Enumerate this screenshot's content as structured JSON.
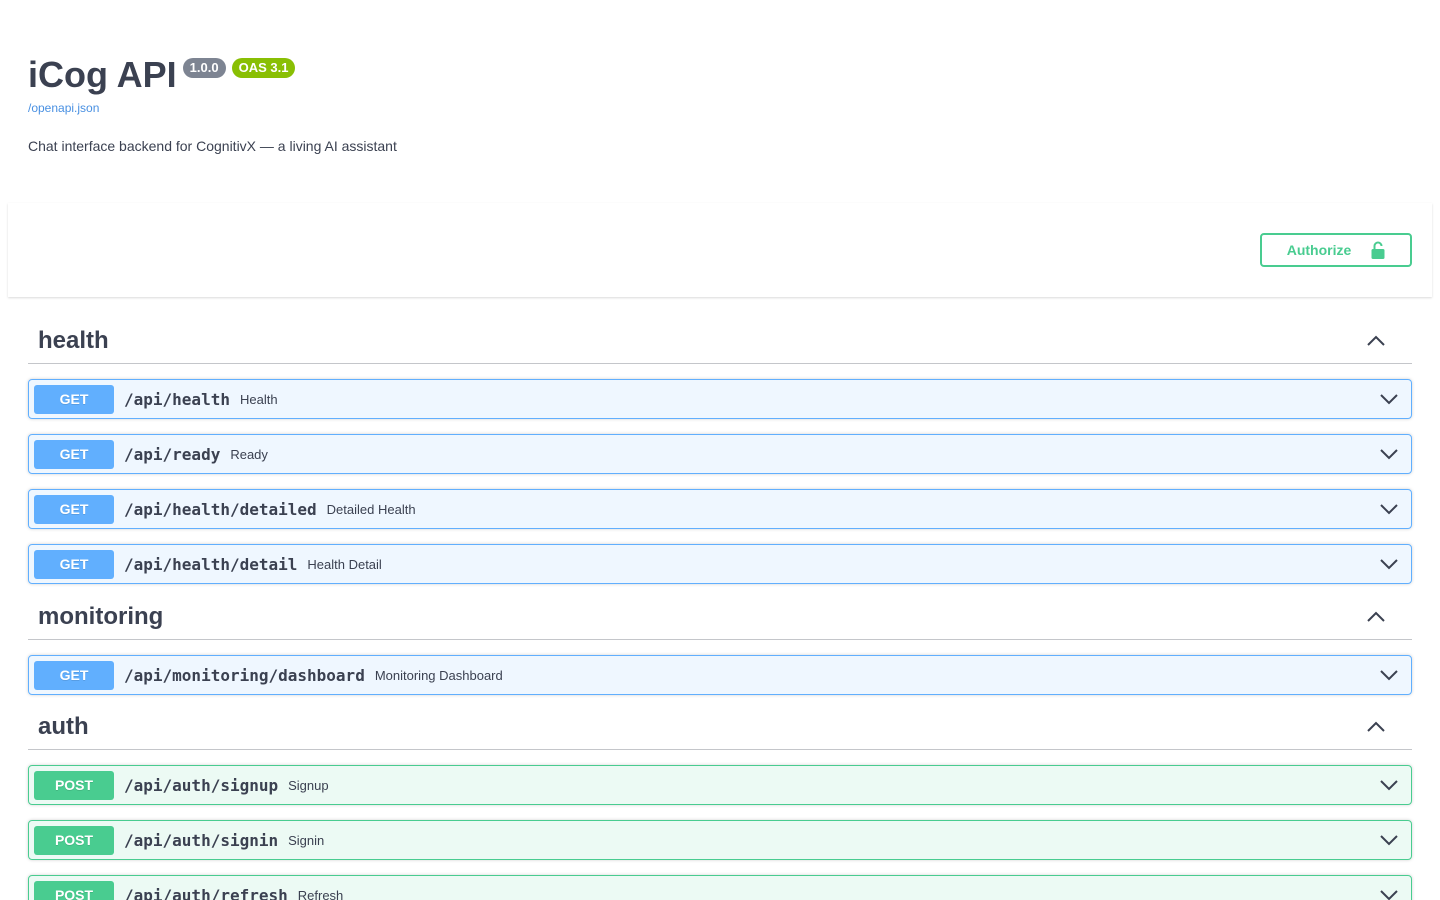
{
  "info": {
    "title": "iCog API",
    "version": "1.0.0",
    "oas": "OAS 3.1",
    "spec_link": "/openapi.json",
    "description": "Chat interface backend for CognitivX — a living AI assistant"
  },
  "authorize": {
    "label": "Authorize"
  },
  "tags": [
    {
      "name": "health",
      "operations": [
        {
          "method": "GET",
          "path": "/api/health",
          "summary": "Health"
        },
        {
          "method": "GET",
          "path": "/api/ready",
          "summary": "Ready"
        },
        {
          "method": "GET",
          "path": "/api/health/detailed",
          "summary": "Detailed Health"
        },
        {
          "method": "GET",
          "path": "/api/health/detail",
          "summary": "Health Detail"
        }
      ]
    },
    {
      "name": "monitoring",
      "operations": [
        {
          "method": "GET",
          "path": "/api/monitoring/dashboard",
          "summary": "Monitoring Dashboard"
        }
      ]
    },
    {
      "name": "auth",
      "operations": [
        {
          "method": "POST",
          "path": "/api/auth/signup",
          "summary": "Signup"
        },
        {
          "method": "POST",
          "path": "/api/auth/signin",
          "summary": "Signin"
        },
        {
          "method": "POST",
          "path": "/api/auth/refresh",
          "summary": "Refresh"
        }
      ]
    }
  ],
  "colors": {
    "get": "#61affe",
    "post": "#49cc90",
    "authorize": "#49cc90",
    "version_badge": "#7d8492",
    "oas_badge": "#89bf04",
    "link": "#4990e2"
  }
}
